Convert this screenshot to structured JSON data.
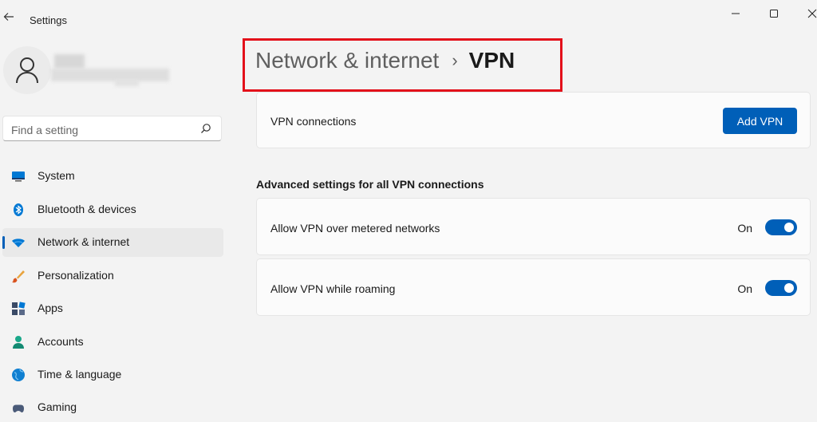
{
  "window": {
    "title": "Settings"
  },
  "search": {
    "placeholder": "Find a setting"
  },
  "sidebar": {
    "items": [
      {
        "label": "System",
        "icon": "system-icon"
      },
      {
        "label": "Bluetooth & devices",
        "icon": "bluetooth-icon"
      },
      {
        "label": "Network & internet",
        "icon": "wifi-icon",
        "active": true
      },
      {
        "label": "Personalization",
        "icon": "brush-icon"
      },
      {
        "label": "Apps",
        "icon": "apps-icon"
      },
      {
        "label": "Accounts",
        "icon": "accounts-icon"
      },
      {
        "label": "Time & language",
        "icon": "globe-icon"
      },
      {
        "label": "Gaming",
        "icon": "gaming-icon"
      }
    ]
  },
  "breadcrumb": {
    "parent": "Network & internet",
    "separator": "›",
    "current": "VPN"
  },
  "vpn": {
    "connections_label": "VPN connections",
    "add_button": "Add VPN"
  },
  "advanced": {
    "title": "Advanced settings for all VPN connections",
    "settings": [
      {
        "label": "Allow VPN over metered networks",
        "state": "On"
      },
      {
        "label": "Allow VPN while roaming",
        "state": "On"
      }
    ]
  },
  "colors": {
    "accent": "#005fb8",
    "highlight_box": "#e3101a"
  }
}
